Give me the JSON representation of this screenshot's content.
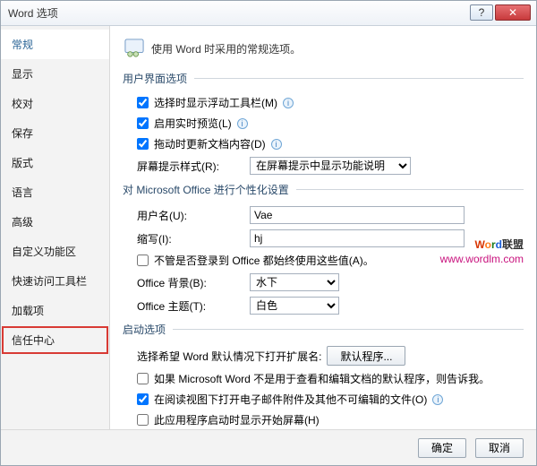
{
  "window": {
    "title": "Word 选项"
  },
  "sidebar": {
    "items": [
      {
        "label": "常规"
      },
      {
        "label": "显示"
      },
      {
        "label": "校对"
      },
      {
        "label": "保存"
      },
      {
        "label": "版式"
      },
      {
        "label": "语言"
      },
      {
        "label": "高级"
      },
      {
        "label": "自定义功能区"
      },
      {
        "label": "快速访问工具栏"
      },
      {
        "label": "加载项"
      },
      {
        "label": "信任中心"
      }
    ]
  },
  "header": {
    "text": "使用 Word 时采用的常规选项。"
  },
  "ui_section": {
    "title": "用户界面选项",
    "mini_toolbar": "选择时显示浮动工具栏(M)",
    "live_preview": "启用实时预览(L)",
    "update_content": "拖动时更新文档内容(D)",
    "screentip_label": "屏幕提示样式(R):",
    "screentip_value": "在屏幕提示中显示功能说明"
  },
  "personalize_section": {
    "title": "对 Microsoft Office 进行个性化设置",
    "username_label": "用户名(U):",
    "username_value": "Vae",
    "initials_label": "缩写(I):",
    "initials_value": "hj",
    "always_use": "不管是否登录到 Office 都始终使用这些值(A)。",
    "bg_label": "Office 背景(B):",
    "bg_value": "水下",
    "theme_label": "Office 主题(T):",
    "theme_value": "白色"
  },
  "startup_section": {
    "title": "启动选项",
    "ext_label": "选择希望 Word 默认情况下打开扩展名:",
    "ext_button": "默认程序...",
    "tell_me": "如果 Microsoft Word 不是用于查看和编辑文档的默认程序，则告诉我。",
    "open_attachments": "在阅读视图下打开电子邮件附件及其他不可编辑的文件(O)",
    "show_start": "此应用程序启动时显示开始屏幕(H)"
  },
  "footer": {
    "ok": "确定",
    "cancel": "取消"
  },
  "watermark": {
    "line1_parts": [
      "W",
      "o",
      "r",
      "d",
      "联盟"
    ],
    "line2": "www.wordlm.com"
  }
}
